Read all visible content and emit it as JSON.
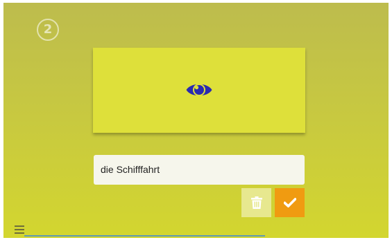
{
  "step": {
    "number": "2"
  },
  "card": {
    "icon": "eye-icon",
    "background": "#dee03a",
    "icon_color": "#2a2ab0"
  },
  "answer": {
    "value": "die Schifffahrt"
  },
  "buttons": {
    "delete": {
      "icon": "trash-icon",
      "background": "#e7e88f"
    },
    "confirm": {
      "icon": "checkmark-icon",
      "background": "#f09b11"
    }
  },
  "menu": {
    "icon": "hamburger-menu-icon"
  },
  "progress": {
    "fraction": 0.66,
    "color": "#5f9bb5"
  }
}
